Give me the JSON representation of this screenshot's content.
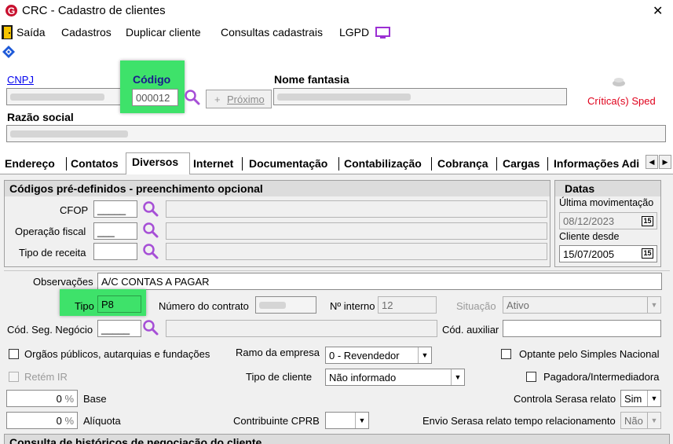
{
  "window": {
    "title": "CRC - Cadastro de clientes",
    "close_glyph": "✕"
  },
  "menu": {
    "items": [
      "Saída",
      "Cadastros",
      "Duplicar cliente",
      "Consultas cadastrais",
      "LGPD"
    ]
  },
  "header": {
    "cnpj_label": "CNPJ",
    "codigo_label": "Código",
    "codigo_value": "000012",
    "proximo_label": "Próximo",
    "nome_fantasia_label": "Nome fantasia",
    "critica_label": "Crítica(s) Sped",
    "razao_social_label": "Razão social"
  },
  "tabs": [
    "Endereço",
    "Contatos",
    "Diversos",
    "Internet",
    "Documentação",
    "Contabilização",
    "Cobrança",
    "Cargas",
    "Informações Adi"
  ],
  "active_tab": "Diversos",
  "codigos_group": {
    "title": "Códigos pré-definidos - preenchimento opcional",
    "fields": [
      {
        "label": "CFOP",
        "value": "_____"
      },
      {
        "label": "Operação fiscal",
        "value": "___"
      },
      {
        "label": "Tipo de receita",
        "value": ""
      }
    ]
  },
  "datas_group": {
    "title": "Datas",
    "ultima_mov_label": "Última movimentação",
    "ultima_mov_value": "08/12/2023",
    "cliente_desde_label": "Cliente desde",
    "cliente_desde_value": "15/07/2005",
    "calendar_glyph": "15"
  },
  "form": {
    "observacoes_label": "Observações",
    "observacoes_value": "A/C CONTAS A PAGAR",
    "tipo_label": "Tipo",
    "tipo_value": "P8",
    "numero_contrato_label": "Número do contrato",
    "numero_interno_label": "Nº interno",
    "numero_interno_value": "12",
    "situacao_label": "Situação",
    "situacao_value": "Ativo",
    "cod_seg_label": "Cód. Seg. Negócio",
    "cod_seg_value": "_____",
    "cod_aux_label": "Cód. auxiliar",
    "orgaos_label": "Orgãos públicos, autarquias e fundações",
    "ramo_label": "Ramo da empresa",
    "ramo_value": "0 - Revendedor",
    "optante_label": "Optante pelo Simples Nacional",
    "retem_label": "Retém IR",
    "tipo_cliente_label": "Tipo de cliente",
    "tipo_cliente_value": "Não informado",
    "pagadora_label": "Pagadora/Intermediadora",
    "base_value": "0",
    "base_pct": "%",
    "base_label": "Base",
    "serasa_label": "Controla Serasa relato",
    "serasa_value": "Sim",
    "aliquota_value": "0",
    "aliquota_pct": "%",
    "aliquota_label": "Alíquota",
    "cprb_label": "Contribuinte CPRB",
    "cprb_value": "",
    "envio_label": "Envio Serasa relato tempo relacionamento",
    "envio_value": "Não"
  },
  "bottom_group_title": "Consulta de históricos de negociação do cliente",
  "colors": {
    "highlight": "#3ee26a",
    "critica": "#e0001b",
    "link": "#0000ee",
    "search_icon": "#a64fd6"
  }
}
